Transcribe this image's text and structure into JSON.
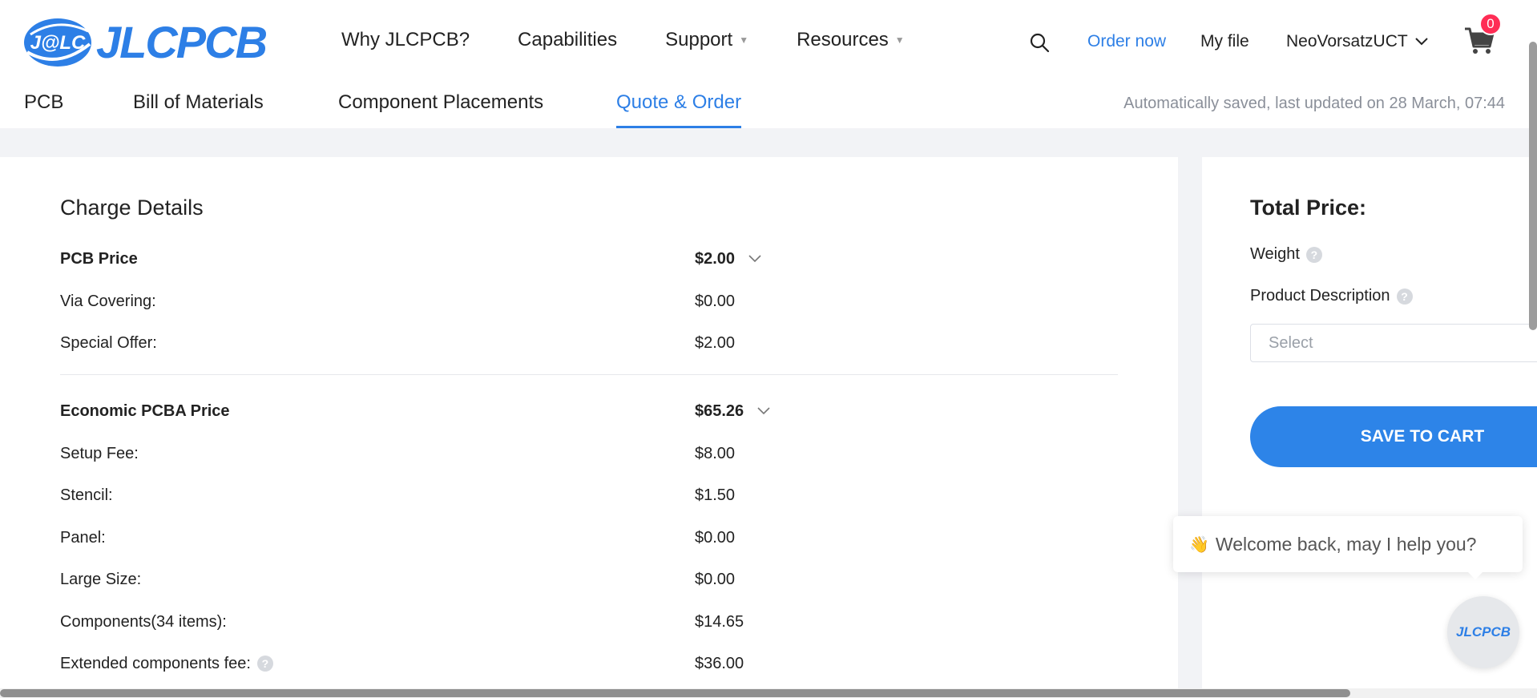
{
  "brand": {
    "logo_text": "JLCPCB",
    "badge_text": "J@LC",
    "accent": "#2d7fe6"
  },
  "nav": {
    "items": [
      {
        "label": "Why JLCPCB?",
        "has_caret": false
      },
      {
        "label": "Capabilities",
        "has_caret": false
      },
      {
        "label": "Support",
        "has_caret": true
      },
      {
        "label": "Resources",
        "has_caret": true
      }
    ],
    "order_now": "Order now",
    "my_file": "My file",
    "user": "NeoVorsatzUCT",
    "cart_count": "0"
  },
  "tabs": {
    "items": [
      "PCB",
      "Bill of Materials",
      "Component Placements",
      "Quote & Order"
    ],
    "active": "Quote & Order",
    "saved_text": "Automatically saved, last updated on 28 March, 07:44"
  },
  "charges": {
    "title": "Charge Details",
    "pcb": {
      "label": "PCB Price",
      "value": "$2.00",
      "rows": [
        {
          "label": "Via Covering:",
          "value": "$0.00"
        },
        {
          "label": "Special Offer:",
          "value": "$2.00"
        }
      ]
    },
    "pcba": {
      "label": "Economic PCBA Price",
      "value": "$65.26",
      "rows": [
        {
          "label": "Setup Fee:",
          "value": "$8.00"
        },
        {
          "label": "Stencil:",
          "value": "$1.50"
        },
        {
          "label": "Panel:",
          "value": "$0.00"
        },
        {
          "label": "Large Size:",
          "value": "$0.00"
        },
        {
          "label": "Components(34 items):",
          "value": "$14.65"
        },
        {
          "label": "Extended components fee:",
          "value": "$36.00"
        }
      ]
    }
  },
  "summary": {
    "title": "Total Price:",
    "weight_label": "Weight",
    "product_desc_label": "Product Description",
    "select_placeholder": "Select",
    "save_button": "SAVE TO CART"
  },
  "chat": {
    "greeting": "Welcome back, may I help you?",
    "wave_emoji": "👋",
    "avatar_text": "JLCPCB"
  }
}
